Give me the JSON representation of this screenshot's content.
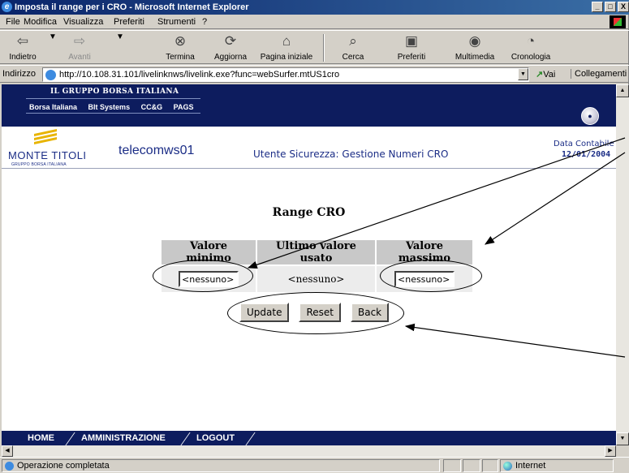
{
  "window": {
    "title": "Imposta il range per i CRO - Microsoft Internet Explorer",
    "controls": [
      "_",
      "□",
      "X"
    ]
  },
  "menu": [
    "File",
    "Modifica",
    "Visualizza",
    "Preferiti",
    "Strumenti",
    "?"
  ],
  "toolbar": {
    "back": "Indietro",
    "forward": "Avanti",
    "stop": "Termina",
    "refresh": "Aggiorna",
    "home": "Pagina iniziale",
    "search": "Cerca",
    "favorites": "Preferiti",
    "media": "Multimedia",
    "history": "Cronologia"
  },
  "address": {
    "label": "Indirizzo",
    "url": "http://10.108.31.101/livelinknws/livelink.exe?func=webSurfer.mtUS1cro",
    "go": "Vai",
    "links": "Collegamenti"
  },
  "header": {
    "group": "IL GRUPPO BORSA ITALIANA",
    "nav": [
      "Borsa Italiana",
      "Blt Systems",
      "CC&G",
      "PAGS"
    ],
    "brand": "MONTE TITOLI",
    "brand_sub": "GRUPPO BORSA ITALIANA",
    "workstation": "telecomws01",
    "subtitle": "Utente Sicurezza: Gestione Numeri CRO",
    "date_label": "Data Contabile",
    "date_value": "12/01/2004"
  },
  "form": {
    "title": "Range CRO",
    "columns": [
      "Valore minimo",
      "Ultimo valore usato",
      "Valore massimo"
    ],
    "min_value": "<nessuno>",
    "last_used": "<nessuno>",
    "max_value": "<nessuno>",
    "buttons": {
      "update": "Update",
      "reset": "Reset",
      "back": "Back"
    }
  },
  "footer_nav": [
    "HOME",
    "AMMINISTRAZIONE",
    "LOGOUT"
  ],
  "status": {
    "text": "Operazione completata",
    "zone": "Internet"
  }
}
